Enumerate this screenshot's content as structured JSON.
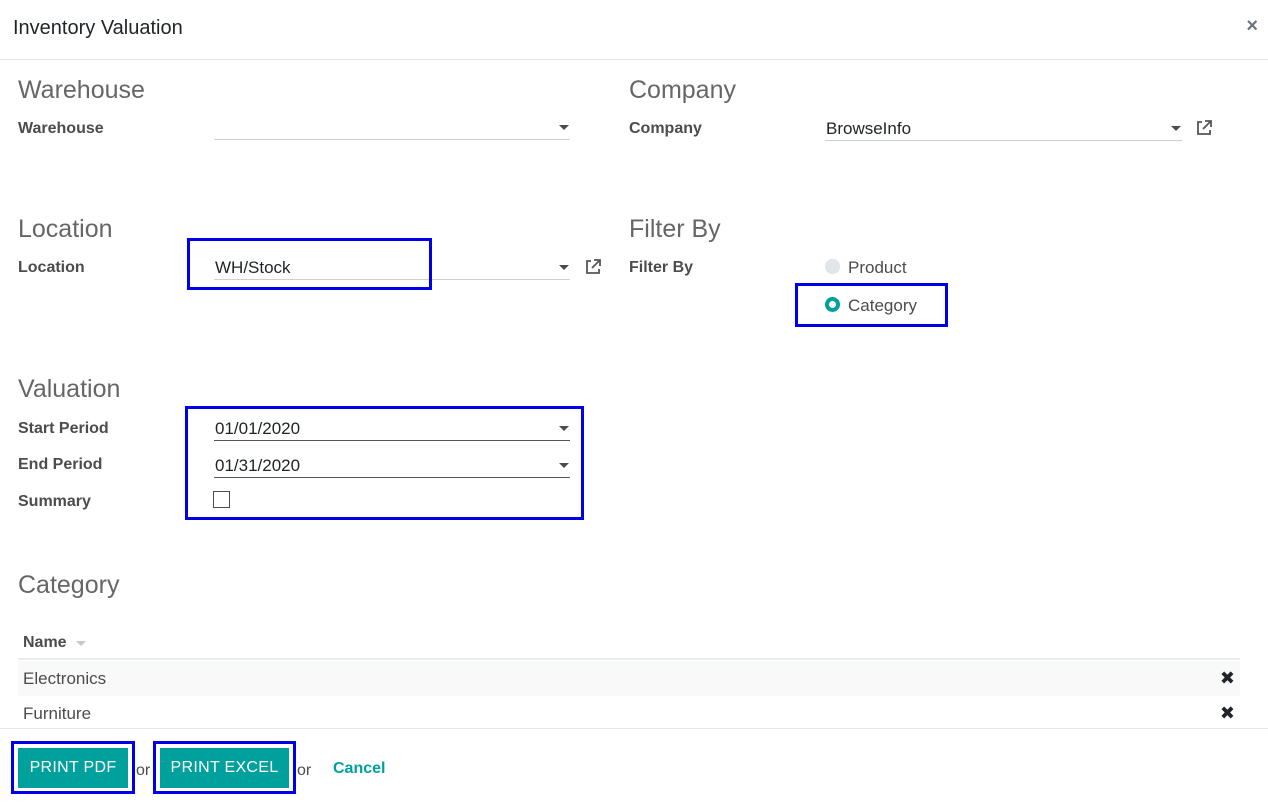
{
  "dialog": {
    "title": "Inventory Valuation",
    "close_glyph": "×"
  },
  "warehouse_section": {
    "title": "Warehouse",
    "label": "Warehouse",
    "value": ""
  },
  "company_section": {
    "title": "Company",
    "label": "Company",
    "value": "BrowseInfo"
  },
  "location_section": {
    "title": "Location",
    "label": "Location",
    "value": "WH/Stock"
  },
  "filter_section": {
    "title": "Filter By",
    "label": "Filter By",
    "options": [
      {
        "label": "Product",
        "selected": false
      },
      {
        "label": "Category",
        "selected": true
      }
    ]
  },
  "valuation_section": {
    "title": "Valuation",
    "start_label": "Start Period",
    "start_value": "01/01/2020",
    "end_label": "End Period",
    "end_value": "01/31/2020",
    "summary_label": "Summary",
    "summary_checked": false
  },
  "category_section": {
    "title": "Category",
    "column_name": "Name",
    "rows": [
      {
        "name": "Electronics"
      },
      {
        "name": "Furniture"
      }
    ],
    "delete_glyph": "✖"
  },
  "footer": {
    "print_pdf_label": "PRINT PDF",
    "or_1": "or",
    "print_excel_label": "PRINT EXCEL",
    "or_2": "or",
    "cancel_label": "Cancel"
  },
  "colors": {
    "accent": "#00a09d",
    "highlight": "#0000e6"
  }
}
